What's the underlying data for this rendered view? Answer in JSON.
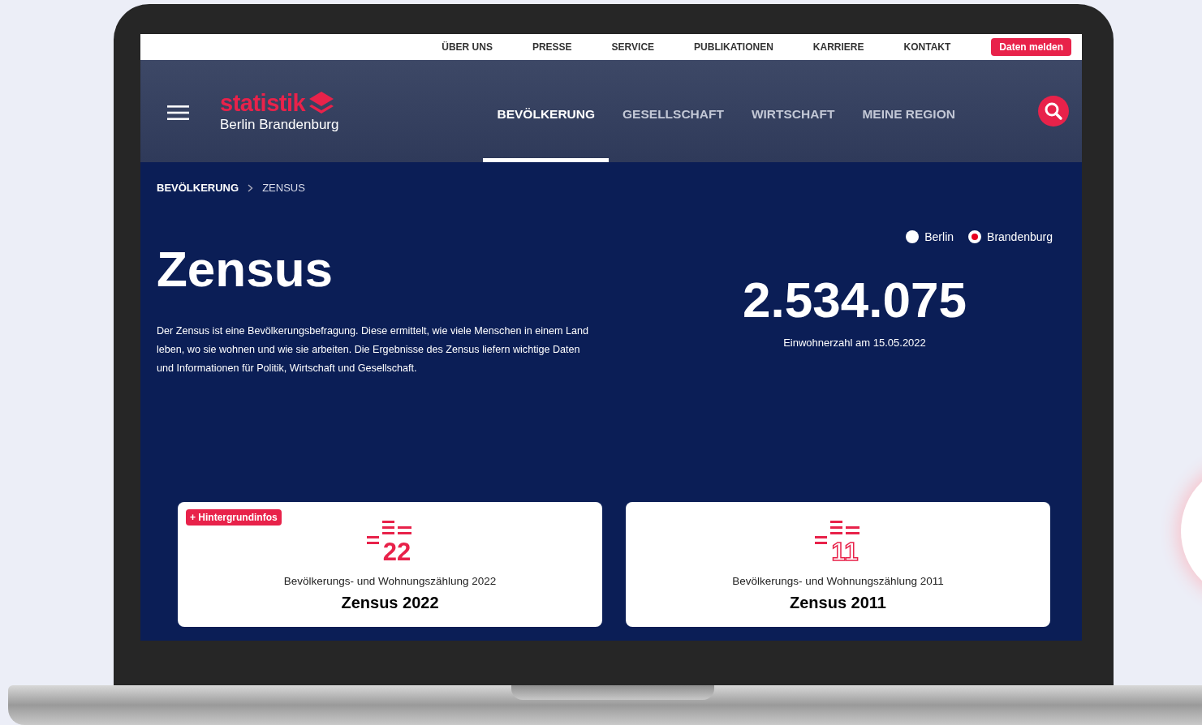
{
  "top_links": [
    {
      "label": "ÜBER UNS"
    },
    {
      "label": "PRESSE"
    },
    {
      "label": "SERVICE"
    },
    {
      "label": "PUBLIKATIONEN"
    },
    {
      "label": "KARRIERE"
    },
    {
      "label": "KONTAKT"
    }
  ],
  "report_button": "Daten melden",
  "logo": {
    "brand": "statistik",
    "subtitle": "Berlin Brandenburg"
  },
  "nav": [
    {
      "label": "BEVÖLKERUNG",
      "selected": true
    },
    {
      "label": "GESELLSCHAFT",
      "selected": false
    },
    {
      "label": "WIRTSCHAFT",
      "selected": false
    },
    {
      "label": "MEINE REGION",
      "selected": false
    }
  ],
  "breadcrumb": [
    {
      "label": "BEVÖLKERUNG",
      "current": false
    },
    {
      "label": "ZENSUS",
      "current": true
    }
  ],
  "title": "Zensus",
  "intro": "Der Zensus ist eine Bevölkerungsbefragung. Diese ermittelt, wie viele Menschen in einem Land leben, wo sie wohnen und wie sie arbeiten. Die Ergebnisse des Zensus liefern wichtige Daten und Informationen für Politik, Wirtschaft und Gesellschaft.",
  "regions": [
    {
      "label": "Berlin",
      "selected": false
    },
    {
      "label": "Brandenburg",
      "selected": true
    }
  ],
  "population": {
    "value": "2.534.075",
    "caption": "Einwohnerzahl am 15.05.2022"
  },
  "cards": [
    {
      "badge": "+ Hintergrundinfos",
      "icon_number": "22",
      "outlined": false,
      "subtitle": "Bevölkerungs- und Wohnungszählung 2022",
      "title": "Zensus 2022"
    },
    {
      "icon_number": "11",
      "outlined": true,
      "subtitle": "Bevölkerungs- und Wohnungszählung 2011",
      "title": "Zensus 2011"
    }
  ]
}
